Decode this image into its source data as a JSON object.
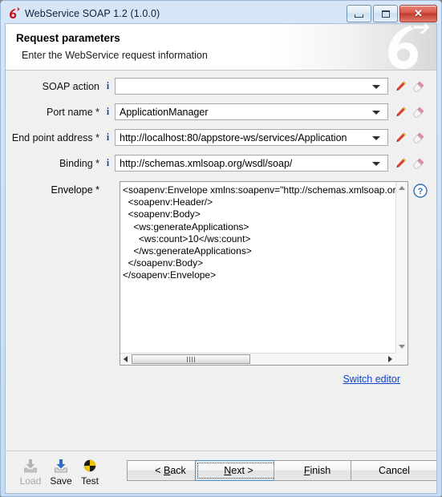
{
  "window": {
    "title": "WebService SOAP 1.2 (1.0.0)",
    "controls": {
      "minimize": "minimize",
      "maximize": "maximize",
      "close": "✕"
    }
  },
  "header": {
    "title": "Request parameters",
    "subtitle": "Enter the WebService request information"
  },
  "form": {
    "fields": [
      {
        "label": "SOAP action",
        "required": false,
        "has_info": true,
        "value": "",
        "edit_icon": "pencil-icon",
        "erase_icon": "eraser-icon"
      },
      {
        "label": "Port name *",
        "required": true,
        "has_info": true,
        "value": "ApplicationManager",
        "edit_icon": "pencil-icon",
        "erase_icon": "eraser-icon"
      },
      {
        "label": "End point address *",
        "required": true,
        "has_info": true,
        "value": "http://localhost:80/appstore-ws/services/Application",
        "edit_icon": "pencil-icon",
        "erase_icon": "eraser-icon"
      },
      {
        "label": "Binding *",
        "required": true,
        "has_info": true,
        "value": "http://schemas.xmlsoap.org/wsdl/soap/",
        "edit_icon": "pencil-icon",
        "erase_icon": "eraser-icon"
      }
    ],
    "envelope": {
      "label": "Envelope *",
      "value": "<soapenv:Envelope xmlns:soapenv=\"http://schemas.xmlsoap.or\n  <soapenv:Header/>\n  <soapenv:Body>\n    <ws:generateApplications>\n      <ws:count>10</ws:count>\n    </ws:generateApplications>\n  </soapenv:Body>\n</soapenv:Envelope>",
      "help_icon": "help-circle-icon"
    },
    "switch_editor_link": "Switch editor"
  },
  "bottom": {
    "tools": [
      {
        "label": "Load",
        "icon": "load-tray-icon",
        "enabled": false
      },
      {
        "label": "Save",
        "icon": "save-tray-icon",
        "enabled": true
      },
      {
        "label": "Test",
        "icon": "globe-test-icon",
        "enabled": true
      }
    ],
    "buttons": [
      {
        "name": "back",
        "prefix": "< ",
        "mnemonic": "B",
        "suffix": "ack",
        "focused": false
      },
      {
        "name": "next",
        "prefix": "",
        "mnemonic": "N",
        "suffix": "ext >",
        "focused": true
      },
      {
        "name": "finish",
        "prefix": "",
        "mnemonic": "F",
        "suffix": "inish",
        "focused": false
      },
      {
        "name": "cancel",
        "prefix": "",
        "mnemonic": "C",
        "suffix": "ancel",
        "focused": false
      }
    ]
  },
  "colors": {
    "accent_blue": "#1d4f8f",
    "link": "#1144cc",
    "logo_red": "#cc0a12",
    "close_red": "#c23a2e"
  }
}
